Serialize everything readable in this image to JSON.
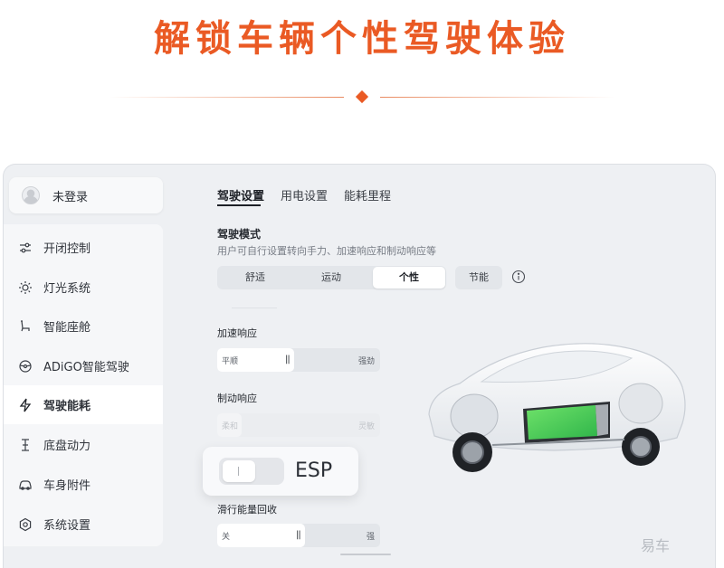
{
  "banner": {
    "title": "解锁车辆个性驾驶体验"
  },
  "login": {
    "label": "未登录"
  },
  "sidebar": {
    "items": [
      {
        "label": "开闭控制",
        "icon": "sliders-icon"
      },
      {
        "label": "灯光系统",
        "icon": "sun-icon"
      },
      {
        "label": "智能座舱",
        "icon": "seat-icon"
      },
      {
        "label": "ADiGO智能驾驶",
        "icon": "steering-wheel-icon"
      },
      {
        "label": "驾驶能耗",
        "icon": "lightning-icon",
        "active": true
      },
      {
        "label": "底盘动力",
        "icon": "chassis-icon"
      },
      {
        "label": "车身附件",
        "icon": "car-icon"
      },
      {
        "label": "系统设置",
        "icon": "settings-icon"
      }
    ]
  },
  "tabs": [
    {
      "label": "驾驶设置",
      "active": true
    },
    {
      "label": "用电设置"
    },
    {
      "label": "能耗里程"
    }
  ],
  "drive_mode": {
    "title": "驾驶模式",
    "description": "用户可自行设置转向手力、加速响应和制动响应等",
    "options": [
      "舒适",
      "运动",
      "个性",
      "节能"
    ],
    "selected": "个性"
  },
  "accel": {
    "label": "加速响应",
    "low": "平顺",
    "high": "强劲",
    "level": 0.47
  },
  "brake": {
    "label": "制动响应",
    "low": "柔和",
    "high": "灵敏",
    "level": 0.15,
    "disabled": true
  },
  "esp": {
    "label": "ESP",
    "on": false
  },
  "regen": {
    "label": "滑行能量回收",
    "low": "关",
    "high": "强",
    "level": 0.54
  },
  "watermark": "易车",
  "colors": {
    "accent": "#ea5a24",
    "battery": "#4cd964"
  }
}
